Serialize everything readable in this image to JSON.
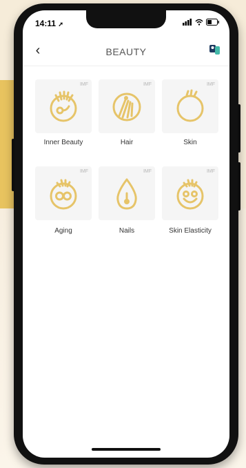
{
  "status": {
    "time": "14:11"
  },
  "header": {
    "title": "BEAUTY"
  },
  "items": [
    {
      "label": "Inner Beauty",
      "badge": "IMF",
      "icon": "inner-beauty-icon"
    },
    {
      "label": "Hair",
      "badge": "IMF",
      "icon": "hair-icon"
    },
    {
      "label": "Skin",
      "badge": "IMF",
      "icon": "skin-icon"
    },
    {
      "label": "Aging",
      "badge": "IMF",
      "icon": "aging-icon"
    },
    {
      "label": "Nails",
      "badge": "IMF",
      "icon": "nails-icon"
    },
    {
      "label": "Skin Elasticity",
      "badge": "IMF",
      "icon": "skin-elasticity-icon"
    }
  ],
  "colors": {
    "accent": "#e6c469",
    "card": "#f5f5f5"
  }
}
